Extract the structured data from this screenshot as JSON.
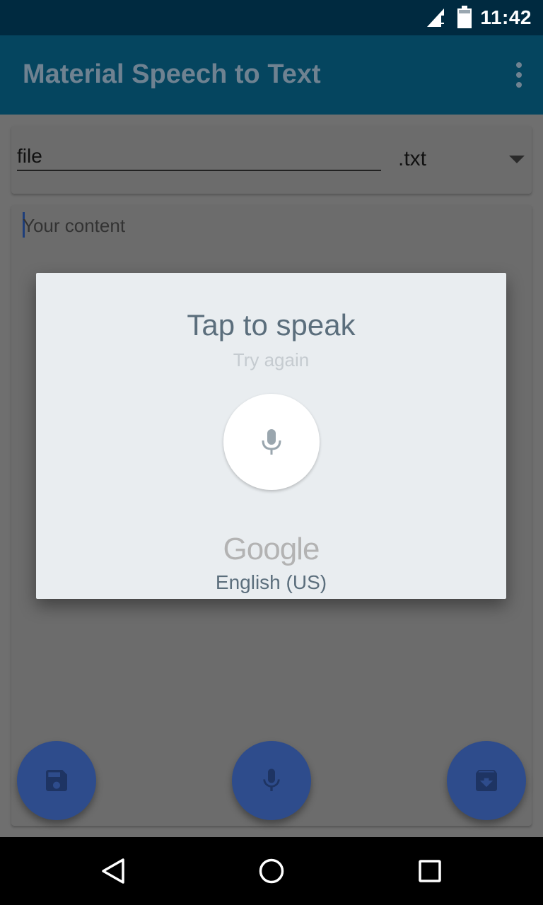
{
  "status_bar": {
    "time": "11:42",
    "icons": [
      "signal-icon",
      "battery-icon"
    ]
  },
  "app_bar": {
    "title": "Material Speech to Text",
    "overflow_icon": "more-vert-icon"
  },
  "file_card": {
    "filename_value": "file",
    "extension": ".txt"
  },
  "content_card": {
    "placeholder": "Your content"
  },
  "fabs": [
    {
      "name": "save",
      "icon": "save-icon"
    },
    {
      "name": "mic",
      "icon": "mic-icon"
    },
    {
      "name": "download",
      "icon": "download-icon"
    }
  ],
  "dialog": {
    "title": "Tap to speak",
    "subtitle": "Try again",
    "logo_text": "Google",
    "language": "English (US)"
  },
  "colors": {
    "status_bar": "#002a40",
    "app_bar": "#05455f",
    "fab": "#2e4c8c",
    "dialog_bg": "#e9edf0",
    "dialog_text": "#5b6e7c"
  }
}
